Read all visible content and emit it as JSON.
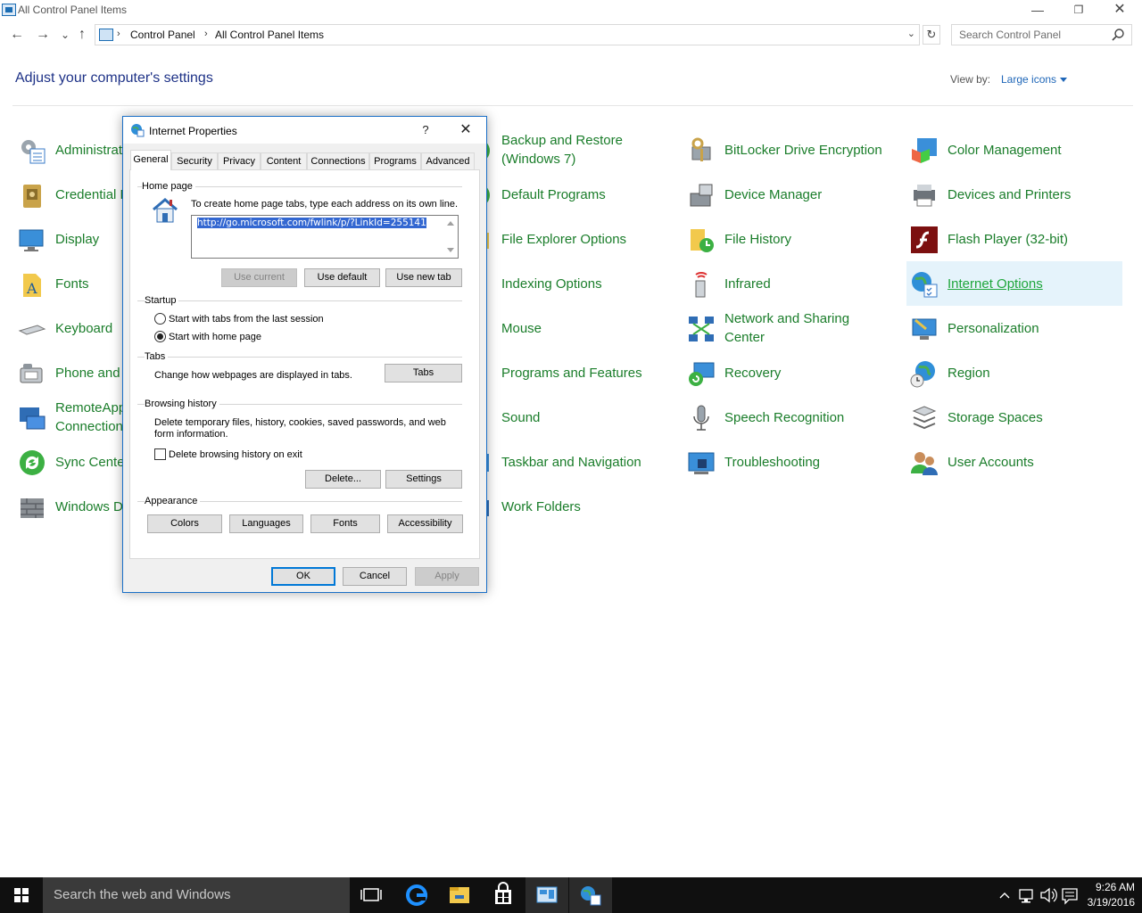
{
  "window": {
    "title": "All Control Panel Items",
    "minimize": "—",
    "maximize": "❐",
    "close": "✕"
  },
  "nav": {
    "back": "←",
    "forward": "→",
    "recent": "⌄",
    "up": "↑",
    "breadcrumb": [
      "Control Panel",
      "All Control Panel Items"
    ],
    "breadcrumb_sep": "›",
    "address_dropdown": "⌄",
    "refresh": "↻",
    "search_placeholder": "Search Control Panel"
  },
  "content": {
    "heading": "Adjust your computer's settings",
    "view_by_label": "View by:",
    "view_by_value": "Large icons"
  },
  "items": {
    "col1": [
      "Administrative Tools",
      "Credential Manager",
      "Display",
      "Fonts",
      "Keyboard",
      "Phone and Modem",
      "RemoteApp and Desktop\nConnections",
      "Sync Center",
      "Windows Defender"
    ],
    "col2": [
      "Backup and Restore\n(Windows 7)",
      "Default Programs",
      "File Explorer Options",
      "Indexing Options",
      "Mouse",
      "Programs and Features",
      "Sound",
      "Taskbar and Navigation",
      "Work Folders"
    ],
    "col3": [
      "BitLocker Drive Encryption",
      "Device Manager",
      "File History",
      "Infrared",
      "Network and Sharing\nCenter",
      "Recovery",
      "Speech Recognition",
      "Troubleshooting"
    ],
    "col4": [
      "Color Management",
      "Devices and Printers",
      "Flash Player (32-bit)",
      "Internet Options",
      "Personalization",
      "Region",
      "Storage Spaces",
      "User Accounts"
    ]
  },
  "dialog": {
    "title": "Internet Properties",
    "help": "?",
    "close": "✕",
    "tabs": [
      "General",
      "Security",
      "Privacy",
      "Content",
      "Connections",
      "Programs",
      "Advanced"
    ],
    "home_page": {
      "group": "Home page",
      "instruction": "To create home page tabs, type each address on its own line.",
      "url": "http://go.microsoft.com/fwlink/p/?LinkId=255141",
      "use_current": "Use current",
      "use_default": "Use default",
      "use_new_tab": "Use new tab"
    },
    "startup": {
      "group": "Startup",
      "option_last_session": "Start with tabs from the last session",
      "option_home_page": "Start with home page",
      "selected": "Start with home page"
    },
    "tabs_group": {
      "group": "Tabs",
      "text": "Change how webpages are displayed in tabs.",
      "button": "Tabs"
    },
    "browsing_history": {
      "group": "Browsing history",
      "text": "Delete temporary files, history, cookies, saved passwords, and web form information.",
      "checkbox_label": "Delete browsing history on exit",
      "delete": "Delete...",
      "settings": "Settings"
    },
    "appearance": {
      "group": "Appearance",
      "colors": "Colors",
      "languages": "Languages",
      "fonts": "Fonts",
      "accessibility": "Accessibility"
    },
    "ok": "OK",
    "cancel": "Cancel",
    "apply": "Apply"
  },
  "taskbar": {
    "search_text": "Search the web and Windows",
    "time": "9:26 AM",
    "date": "3/19/2016"
  },
  "colors": {
    "link_green": "#1a7d2a",
    "heading_blue": "#1e3287",
    "accent_blue": "#0078d7",
    "taskbar": "#101010"
  }
}
